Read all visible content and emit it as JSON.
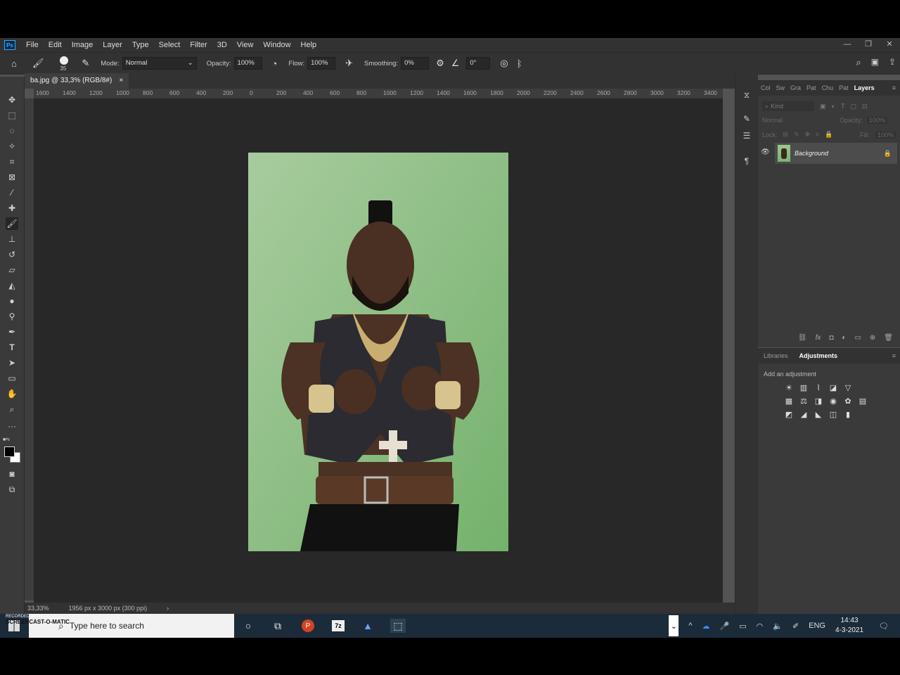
{
  "menu": {
    "logo": "Ps",
    "items": [
      "File",
      "Edit",
      "Image",
      "Layer",
      "Type",
      "Select",
      "Filter",
      "3D",
      "View",
      "Window",
      "Help"
    ]
  },
  "options": {
    "brush_size": "35",
    "mode_label": "Mode:",
    "mode_value": "Normal",
    "opacity_label": "Opacity:",
    "opacity_value": "100%",
    "flow_label": "Flow:",
    "flow_value": "100%",
    "smoothing_label": "Smoothing:",
    "smoothing_value": "0%",
    "angle_value": "0°"
  },
  "document": {
    "tab_title": "ba.jpg @ 33,3% (RGB/8#)",
    "close": "×"
  },
  "ruler": {
    "h_labels": [
      "1600",
      "1400",
      "1200",
      "1000",
      "800",
      "600",
      "400",
      "200",
      "0",
      "200",
      "400",
      "600",
      "800",
      "1000",
      "1200",
      "1400",
      "1600",
      "1800",
      "2000",
      "2200",
      "2400",
      "2600",
      "2800",
      "3000",
      "3200",
      "3400"
    ]
  },
  "status": {
    "zoom": "33,33%",
    "doc_info": "1956 px x 3000 px (300 ppi)",
    "arrow": "›"
  },
  "panels": {
    "top_tabs": [
      "Col",
      "Sw",
      "Gra",
      "Pat",
      "Chu",
      "Pat",
      "Layers"
    ],
    "kind_placeholder": "Kind",
    "blend_mode": "Normal",
    "opacity_label": "Opacity:",
    "opacity_value": "100%",
    "lock_label": "Lock:",
    "fill_label": "Fill:",
    "fill_value": "100%",
    "layer_name": "Background",
    "bottom_tabs": [
      "Libraries",
      "Adjustments"
    ],
    "add_adjustment": "Add an adjustment"
  },
  "taskbar": {
    "search_placeholder": "Type here to search",
    "watermark_top": "RECORDED WITH",
    "watermark_bottom": "SCREENCAST-O-MATIC",
    "lang": "ENG",
    "time": "14:43",
    "date": "4-3-2021"
  },
  "colors": {
    "ps_dark": "#323232",
    "canvas": "#282828",
    "ps_blue": "#31a8ff"
  }
}
